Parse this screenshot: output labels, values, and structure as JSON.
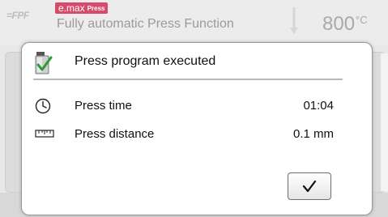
{
  "header": {
    "logo": "=FPF",
    "badge_main": "e.max",
    "badge_small": "Press",
    "title": "Fully automatic Press Function",
    "temperature": "800",
    "temperature_unit": "°C"
  },
  "dialog": {
    "title": "Press program executed",
    "rows": [
      {
        "label": "Press time",
        "value": "01:04",
        "icon": "clock-icon"
      },
      {
        "label": "Press distance",
        "value": "0.1 mm",
        "icon": "ruler-icon"
      }
    ],
    "ok_icon": "checkmark-icon"
  },
  "colors": {
    "badge": "#d64b6a",
    "check_green": "#2e9b3a"
  }
}
